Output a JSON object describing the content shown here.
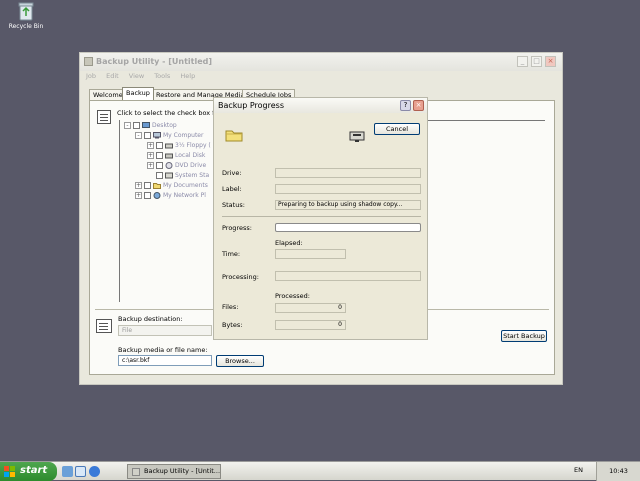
{
  "desktop": {
    "recycle_bin_label": "Recycle Bin"
  },
  "window": {
    "title": "Backup Utility - [Untitled]",
    "menu": [
      "Job",
      "Edit",
      "View",
      "Tools",
      "Help"
    ],
    "tabs": [
      "Welcome",
      "Backup",
      "Restore and Manage Media",
      "Schedule Jobs"
    ],
    "active_tab": "Backup",
    "hint": "Click to select the check box for",
    "tree": [
      {
        "label": "Desktop",
        "icon": "desktop-icon"
      },
      {
        "label": "My Computer",
        "icon": "computer-icon"
      },
      {
        "label": "3½ Floppy (",
        "icon": "floppy-icon"
      },
      {
        "label": "Local Disk",
        "icon": "disk-icon"
      },
      {
        "label": "DVD Drive",
        "icon": "dvd-icon"
      },
      {
        "label": "System Sta",
        "icon": "system-state-icon"
      },
      {
        "label": "My Documents",
        "icon": "folder-icon"
      },
      {
        "label": "My Network Pl",
        "icon": "network-icon"
      }
    ],
    "backup_destination_label": "Backup destination:",
    "backup_destination_value": "File",
    "media_label": "Backup media or file name:",
    "media_value": "c:\\asr.bkf",
    "browse_label": "Browse...",
    "start_backup_label": "Start Backup"
  },
  "dialog": {
    "title": "Backup Progress",
    "help_glyph": "?",
    "close_glyph": "×",
    "cancel_label": "Cancel",
    "drive_label": "Drive:",
    "drive_value": "",
    "label_label": "Label:",
    "label_value": "",
    "status_label": "Status:",
    "status_value": "Preparing to backup using shadow copy...",
    "progress_label": "Progress:",
    "progress_fraction": 0,
    "elapsed_label": "Elapsed:",
    "time_label": "Time:",
    "time_value": "",
    "processing_label": "Processing:",
    "processing_value": "",
    "processed_label": "Processed:",
    "files_label": "Files:",
    "files_value": "0",
    "bytes_label": "Bytes:",
    "bytes_value": "0"
  },
  "taskbar": {
    "start_label": "start",
    "task_label": "Backup Utility - [Untit...",
    "language": "EN",
    "clock": "10:43"
  },
  "colors": {
    "desktop": "#585868",
    "start_green": "#3a963a",
    "dialog_close": "#e8a090"
  }
}
